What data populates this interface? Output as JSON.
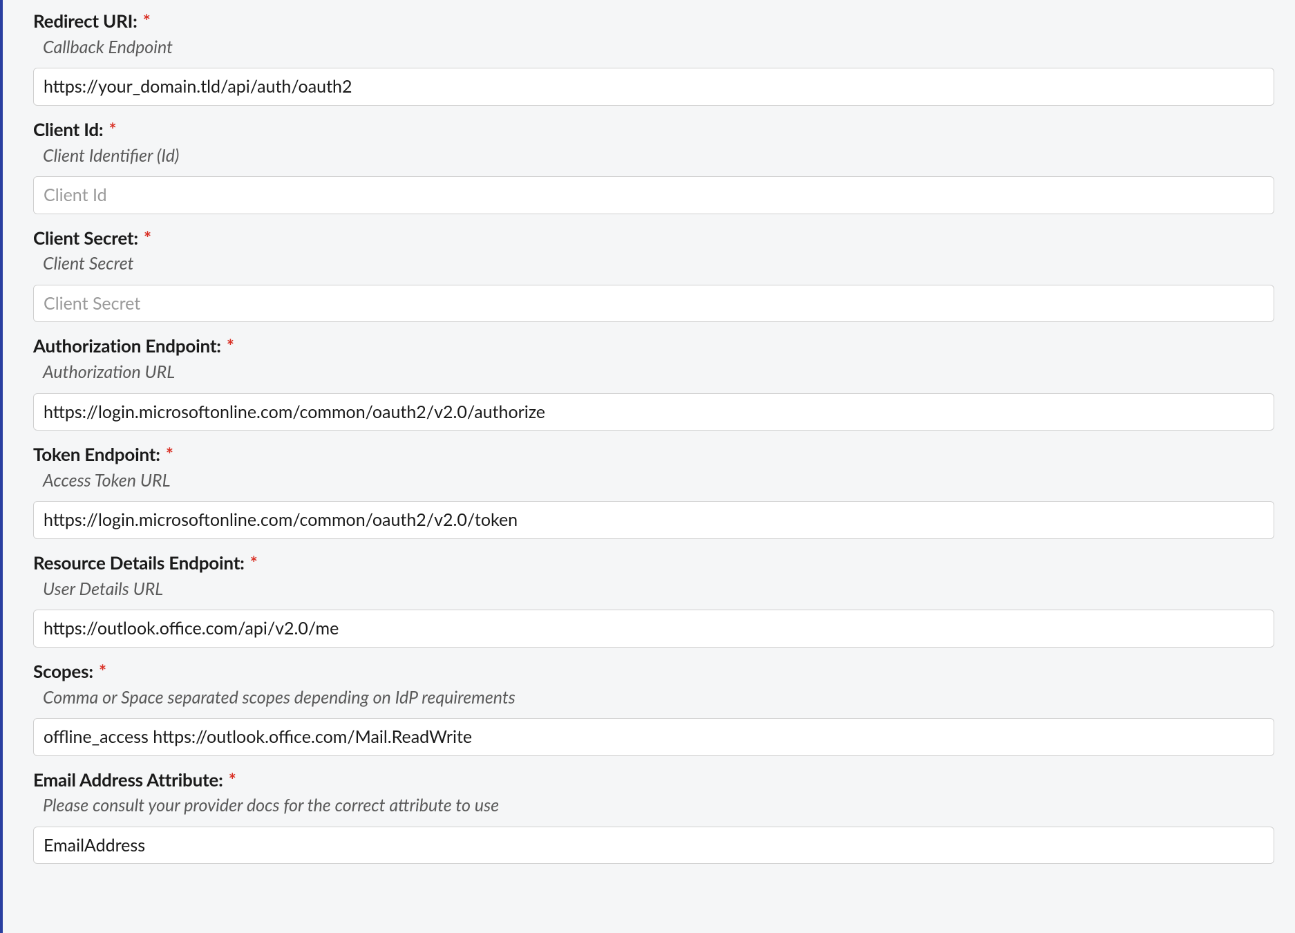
{
  "form": {
    "fields": [
      {
        "label": "Redirect URI:",
        "required": "*",
        "help": "Callback Endpoint",
        "value": "https://your_domain.tld/api/auth/oauth2",
        "placeholder": ""
      },
      {
        "label": "Client Id:",
        "required": "*",
        "help": "Client Identifier (Id)",
        "value": "",
        "placeholder": "Client Id"
      },
      {
        "label": "Client Secret:",
        "required": "*",
        "help": "Client Secret",
        "value": "",
        "placeholder": "Client Secret"
      },
      {
        "label": "Authorization Endpoint:",
        "required": "*",
        "help": "Authorization URL",
        "value": "https://login.microsoftonline.com/common/oauth2/v2.0/authorize",
        "placeholder": ""
      },
      {
        "label": "Token Endpoint:",
        "required": "*",
        "help": "Access Token URL",
        "value": "https://login.microsoftonline.com/common/oauth2/v2.0/token",
        "placeholder": ""
      },
      {
        "label": "Resource Details Endpoint:",
        "required": "*",
        "help": "User Details URL",
        "value": "https://outlook.office.com/api/v2.0/me",
        "placeholder": ""
      },
      {
        "label": "Scopes:",
        "required": "*",
        "help": "Comma or Space separated scopes depending on IdP requirements",
        "value": "offline_access https://outlook.office.com/Mail.ReadWrite",
        "placeholder": ""
      },
      {
        "label": "Email Address Attribute:",
        "required": "*",
        "help": "Please consult your provider docs for the correct attribute to use",
        "value": "EmailAddress",
        "placeholder": ""
      }
    ]
  }
}
